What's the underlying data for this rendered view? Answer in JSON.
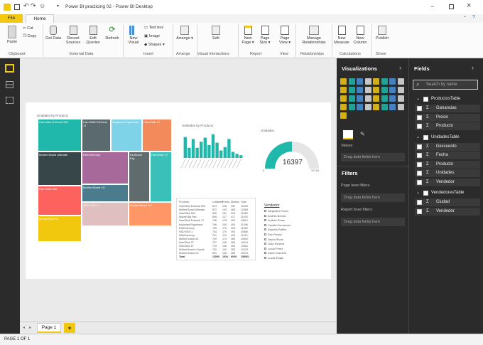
{
  "window": {
    "title": "Power BI practicing 02 - Power BI Desktop"
  },
  "tabs": {
    "file": "File",
    "home": "Home"
  },
  "ribbon": {
    "paste": "Paste",
    "cut": "Cut",
    "copy": "Copy",
    "get_data": "Get Data",
    "recent_sources": "Recent Sources",
    "edit_queries": "Edit Queries",
    "refresh": "Refresh",
    "new_visual": "New Visual",
    "text_box": "Text box",
    "image": "Image",
    "shapes": "Shapes",
    "arrange": "Arrange",
    "edit": "Edit",
    "new_page": "New Page",
    "page_size": "Page Size",
    "page_view": "Page View",
    "manage_relationships": "Manage Relationships",
    "new_measure": "New Measure",
    "new_column": "New Column",
    "publish": "Publish",
    "groups": {
      "clipboard": "Clipboard",
      "external_data": "External Data",
      "insert": "Insert",
      "arrange": "Arrange",
      "visual_interactions": "Visual Interactions",
      "report": "Report",
      "view": "View",
      "relationships": "Relationships",
      "calculations": "Calculations",
      "share": "Share"
    }
  },
  "treemap": {
    "title": "Unidades by Producto",
    "cells": [
      {
        "label": "Hard Disk External 500",
        "color": "#1fb8aa"
      },
      {
        "label": "Hard Disk External 1T",
        "color": "#5a6a6f"
      },
      {
        "label": "Keyboard Ergonomic",
        "color": "#7fd3e8"
      },
      {
        "label": "Hard Disk 1T",
        "color": "#f28a5c"
      },
      {
        "label": "Mother Board Ultimate",
        "color": "#374649"
      },
      {
        "label": "RAM Memory",
        "color": "#a66999"
      },
      {
        "label": "Keyboard Erg...",
        "color": "#5f6b6d"
      },
      {
        "label": "Hard Disk 2T",
        "color": "#3ac0b8"
      },
      {
        "label": "Mother Board 4G",
        "color": "#4a7c8e"
      },
      {
        "label": "Hard Disk 500",
        "color": "#fd625e"
      },
      {
        "label": "Mouse Big Pad",
        "color": "#f2c80f"
      },
      {
        "label": "HDD SSD 1",
        "color": "#dfbfbf"
      },
      {
        "label": "Mother Board 3G",
        "color": "#fe9666"
      }
    ]
  },
  "bar_chart": {
    "title": "Unidades by Producto",
    "color": "#1fb8aa"
  },
  "chart_data": {
    "type": "bar",
    "title": "Unidades by Producto",
    "categories": [
      "1",
      "2",
      "3",
      "4",
      "5",
      "6",
      "7",
      "8",
      "9",
      "10",
      "11",
      "12",
      "13",
      "14",
      "15"
    ],
    "values": [
      62,
      30,
      56,
      30,
      48,
      60,
      38,
      70,
      45,
      22,
      32,
      56,
      18,
      12,
      8
    ],
    "ylim": [
      0,
      80
    ]
  },
  "gauge": {
    "title": "Unidades",
    "value": "16397",
    "min": "0",
    "max": "32794",
    "fill_fraction": 0.5,
    "color": "#1fb8aa"
  },
  "table": {
    "headers": [
      "Producto",
      "Unidades",
      "Precio",
      "Modelo",
      "Total"
    ],
    "rows": [
      [
        "Hard Disk External 500",
        "873",
        "108",
        "459",
        "11504"
      ],
      [
        "Mother Board Ultimate",
        "872",
        "149",
        "465",
        "12389"
      ],
      [
        "Hard Disk 500",
        "826",
        "181",
        "415",
        "11660"
      ],
      [
        "Mouse Big Pad",
        "808",
        "127",
        "417",
        "11003"
      ],
      [
        "Hard Disk External 1T",
        "796",
        "178",
        "403",
        "10821"
      ],
      [
        "Keyboard Ergonomic",
        "766",
        "109",
        "400",
        "11046"
      ],
      [
        "RAM Memory",
        "765",
        "179",
        "404",
        "11260"
      ],
      [
        "HDD SSD 1",
        "754",
        "179",
        "392",
        "10880"
      ],
      [
        "RAM Memory",
        "751",
        "113",
        "403",
        "11140"
      ],
      [
        "Mother Board 4G",
        "749",
        "173",
        "389",
        "10902"
      ],
      [
        "Hard Disk 2T",
        "707",
        "148",
        "360",
        "10413"
      ],
      [
        "Hard Disk 1T",
        "703",
        "136",
        "393",
        "10451"
      ],
      [
        "Mother Board 4 Inputs",
        "700",
        "140",
        "353",
        "10120"
      ],
      [
        "Mother Board 3G",
        "691",
        "108",
        "355",
        "10076"
      ],
      [
        "Total",
        "11590",
        "1534",
        "6009",
        "158061"
      ]
    ]
  },
  "slicer": {
    "title": "Vendedor",
    "items": [
      "Alejandra Flores",
      "Andrés Bernal",
      "Andrés Rivas",
      "Camila Fernández",
      "Daniela Patiño",
      "Flor Rivera",
      "Jesús Rivas",
      "Juan Eiranca",
      "Lucía Pérez",
      "Karen Garnelo",
      "Lucas Rojas"
    ]
  },
  "pages": {
    "page1": "Page 1",
    "add": "+"
  },
  "status": {
    "text": "PAGE 1 OF 1"
  },
  "viz_pane": {
    "title": "Visualizations",
    "values_label": "Values",
    "drag_hint": "Drag data fields here",
    "filters_title": "Filters",
    "page_level": "Page level filters",
    "page_drag": "Drag data fields here",
    "report_level": "Report level filters",
    "report_drag": "Drag data fields here"
  },
  "fields_pane": {
    "title": "Fields",
    "search_placeholder": "Search by name",
    "tables": [
      {
        "name": "ProductosTable",
        "fields": [
          "Ganancias",
          "Precio",
          "Producto"
        ]
      },
      {
        "name": "UnidadesTable",
        "fields": [
          "Descuento",
          "Fecha",
          "Producto",
          "Unidades",
          "Vendedor"
        ]
      },
      {
        "name": "VendedoresTable",
        "fields": [
          "Ciudad",
          "Vendedor"
        ]
      }
    ]
  }
}
